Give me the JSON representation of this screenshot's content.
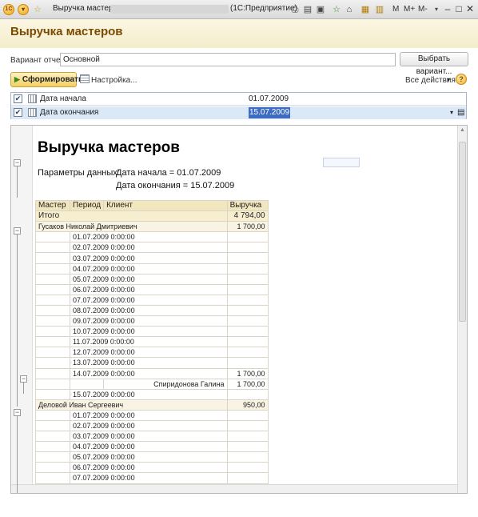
{
  "window": {
    "title": "Выручка мастеров",
    "app": "(1С:Предприятие)",
    "tb_m": "M",
    "tb_mplus": "M+",
    "tb_mminus": "M-"
  },
  "header": {
    "title": "Выручка мастеров"
  },
  "variant": {
    "label": "Вариант отчета:",
    "value": "Основной",
    "choose_button": "Выбрать вариант..."
  },
  "toolbar": {
    "generate": "Сформировать",
    "settings": "Настройка...",
    "all_actions": "Все действия"
  },
  "settings": [
    {
      "name": "Дата начала",
      "value": "01.07.2009"
    },
    {
      "name": "Дата окончания",
      "value": "15.07.2009"
    }
  ],
  "report": {
    "title": "Выручка мастеров",
    "params_label": "Параметры данных:",
    "param1": "Дата начала = 01.07.2009",
    "param2": "Дата окончания = 15.07.2009",
    "columns": [
      "Мастер",
      "Период",
      "Клиент",
      "Выручка"
    ],
    "total_label": "Итого",
    "total_value": "4 794,00",
    "rows": [
      {
        "type": "master",
        "text": "Гусаков Николай Дмитриевич",
        "value": "1 700,00"
      },
      {
        "type": "date",
        "text": "01.07.2009 0:00:00",
        "value": ""
      },
      {
        "type": "date",
        "text": "02.07.2009 0:00:00",
        "value": ""
      },
      {
        "type": "date",
        "text": "03.07.2009 0:00:00",
        "value": ""
      },
      {
        "type": "date",
        "text": "04.07.2009 0:00:00",
        "value": ""
      },
      {
        "type": "date",
        "text": "05.07.2009 0:00:00",
        "value": ""
      },
      {
        "type": "date",
        "text": "06.07.2009 0:00:00",
        "value": ""
      },
      {
        "type": "date",
        "text": "07.07.2009 0:00:00",
        "value": ""
      },
      {
        "type": "date",
        "text": "08.07.2009 0:00:00",
        "value": ""
      },
      {
        "type": "date",
        "text": "09.07.2009 0:00:00",
        "value": ""
      },
      {
        "type": "date",
        "text": "10.07.2009 0:00:00",
        "value": ""
      },
      {
        "type": "date",
        "text": "11.07.2009 0:00:00",
        "value": ""
      },
      {
        "type": "date",
        "text": "12.07.2009 0:00:00",
        "value": ""
      },
      {
        "type": "date",
        "text": "13.07.2009 0:00:00",
        "value": ""
      },
      {
        "type": "date",
        "text": "14.07.2009 0:00:00",
        "value": "1 700,00"
      },
      {
        "type": "client",
        "text": "Спиридонова Галина",
        "value": "1 700,00"
      },
      {
        "type": "date",
        "text": "15.07.2009 0:00:00",
        "value": ""
      },
      {
        "type": "master",
        "text": "Деловой Иван Сергеевич",
        "value": "950,00"
      },
      {
        "type": "date",
        "text": "01.07.2009 0:00:00",
        "value": ""
      },
      {
        "type": "date",
        "text": "02.07.2009 0:00:00",
        "value": ""
      },
      {
        "type": "date",
        "text": "03.07.2009 0:00:00",
        "value": ""
      },
      {
        "type": "date",
        "text": "04.07.2009 0:00:00",
        "value": ""
      },
      {
        "type": "date",
        "text": "05.07.2009 0:00:00",
        "value": ""
      },
      {
        "type": "date",
        "text": "06.07.2009 0:00:00",
        "value": ""
      },
      {
        "type": "date",
        "text": "07.07.2009 0:00:00",
        "value": ""
      }
    ]
  }
}
